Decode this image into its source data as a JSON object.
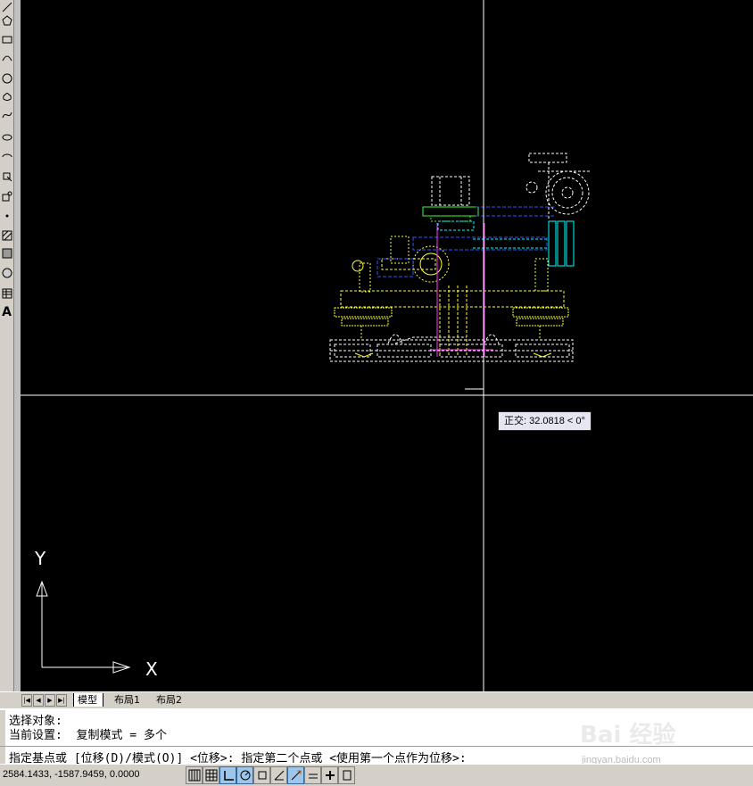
{
  "colors": {
    "background": "#000000",
    "crosshair": "#ffffff",
    "drawing_yellow": "#ffff33",
    "drawing_white": "#ffffff",
    "drawing_cyan": "#00ffff",
    "drawing_blue": "#3355ff",
    "drawing_green": "#33ff33",
    "drawing_magenta": "#ff33ff",
    "ui_gray": "#d4d0c8"
  },
  "toolbar": {
    "tools": [
      "line-icon",
      "polygon-icon",
      "rectangle-icon",
      "arc-icon",
      "circle-icon",
      "revision-cloud-icon",
      "spline-icon",
      "ellipse-icon",
      "ellipse-arc-icon",
      "insert-block-icon",
      "make-block-icon",
      "point-icon",
      "hatch-icon",
      "gradient-icon",
      "region-icon",
      "table-icon",
      "multiline-text-icon"
    ],
    "text_tool_label": "A"
  },
  "ucs": {
    "y_label": "Y",
    "x_label": "X"
  },
  "tooltip": {
    "text": "正交: 32.0818 < 0°"
  },
  "tabs": {
    "items": [
      {
        "label": "模型",
        "active": true
      },
      {
        "label": "布局1",
        "active": false
      },
      {
        "label": "布局2",
        "active": false
      }
    ]
  },
  "command": {
    "lines": [
      "选择对象:",
      "当前设置:  复制模式 = 多个",
      "指定基点或 [位移(D)/模式(O)] <位移>: 指定第二个点或 <使用第一个点作为位移>:"
    ]
  },
  "status": {
    "coords": "2584.1433, -1587.9459, 0.0000",
    "buttons": [
      "snap-icon",
      "grid-icon",
      "ortho-icon",
      "polar-icon",
      "osnap-icon",
      "otrack-icon",
      "ducs-icon",
      "dyn-icon",
      "lwt-icon",
      "qp-icon"
    ],
    "active": [
      2,
      3,
      6
    ]
  },
  "watermark": {
    "text": "jingyan.baidu.com",
    "logo": "Bai 经验"
  }
}
